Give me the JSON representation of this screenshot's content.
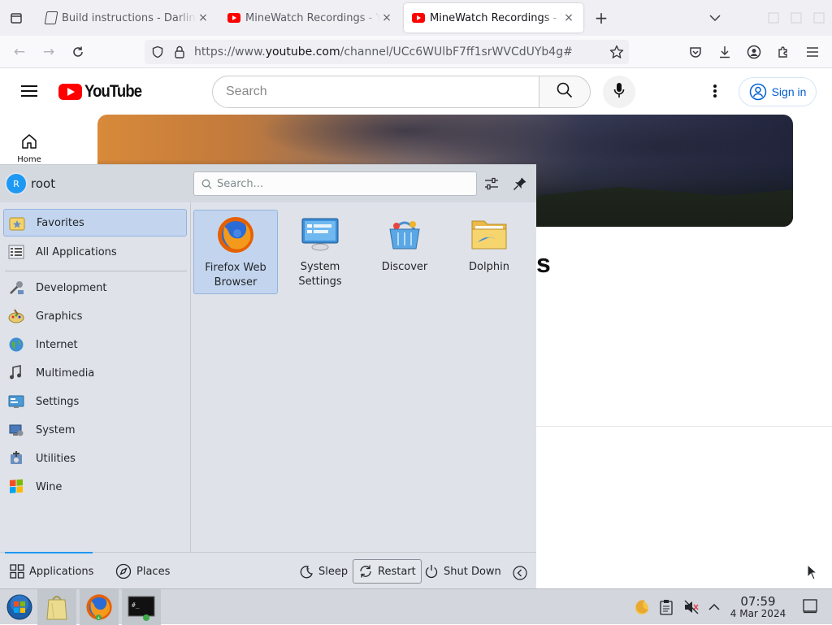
{
  "browser": {
    "tabs": [
      {
        "title": "Build instructions - Darling",
        "close": "×",
        "active": false,
        "favicon": "doc-icon"
      },
      {
        "title": "MineWatch Recordings - YouTube",
        "close": "×",
        "active": false,
        "favicon": "youtube-icon"
      },
      {
        "title": "MineWatch Recordings - YouTube",
        "close": "×",
        "active": true,
        "favicon": "youtube-icon"
      }
    ],
    "new_tab": "+",
    "url_prefix": "https://www.",
    "url_domain": "youtube.com",
    "url_path": "/channel/UCc6WUlbF7ff1srWVCdUYb4g#"
  },
  "youtube": {
    "logo_text": "YouTube",
    "search_placeholder": "Search",
    "sign_in": "Sign in",
    "home_label": "Home",
    "channel_title_fragment": "s"
  },
  "launcher": {
    "user": {
      "initial": "R",
      "name": "root"
    },
    "search_placeholder": "Search...",
    "categories": [
      {
        "label": "Favorites",
        "icon": "star-folder-icon",
        "selected": true
      },
      {
        "label": "All Applications",
        "icon": "grid-list-icon",
        "selected": false
      },
      {
        "label": "Development",
        "icon": "development-icon",
        "selected": false
      },
      {
        "label": "Graphics",
        "icon": "graphics-icon",
        "selected": false
      },
      {
        "label": "Internet",
        "icon": "globe-icon",
        "selected": false
      },
      {
        "label": "Multimedia",
        "icon": "multimedia-icon",
        "selected": false
      },
      {
        "label": "Settings",
        "icon": "settings-icon",
        "selected": false
      },
      {
        "label": "System",
        "icon": "system-icon",
        "selected": false
      },
      {
        "label": "Utilities",
        "icon": "utilities-icon",
        "selected": false
      },
      {
        "label": "Wine",
        "icon": "wine-icon",
        "selected": false
      }
    ],
    "apps": [
      {
        "line1": "Firefox Web",
        "line2": "Browser",
        "icon": "firefox-icon",
        "selected": true
      },
      {
        "line1": "System",
        "line2": "Settings",
        "icon": "system-settings-icon",
        "selected": false
      },
      {
        "line1": "Discover",
        "line2": "",
        "icon": "discover-icon",
        "selected": false
      },
      {
        "line1": "Dolphin",
        "line2": "",
        "icon": "dolphin-folder-icon",
        "selected": false
      }
    ],
    "footer": {
      "applications": "Applications",
      "places": "Places",
      "sleep": "Sleep",
      "restart": "Restart",
      "shutdown": "Shut Down"
    }
  },
  "taskbar": {
    "time": "07:59",
    "date": "4 Mar 2024"
  },
  "colors": {
    "youtube_red": "#ff0000",
    "plasma_selection": "#c3d5ee",
    "plasma_accent": "#1d99f3",
    "link_blue": "#065fd4"
  }
}
